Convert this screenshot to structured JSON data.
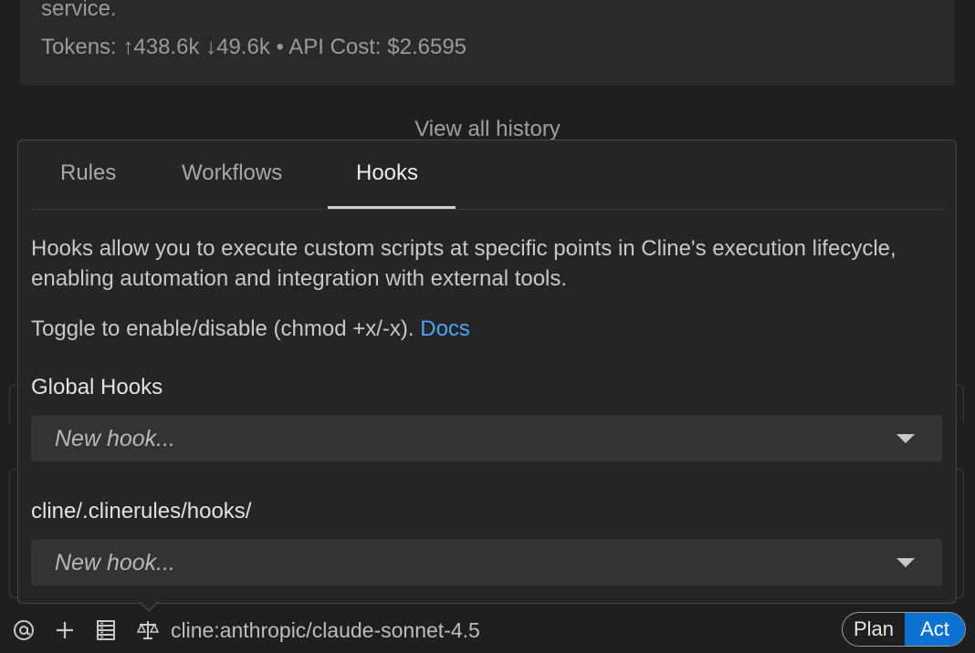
{
  "history": {
    "tail_text": "service.",
    "tokens_text": "Tokens: ↑438.6k ↓49.6k • API Cost: $2.6595",
    "view_all_label": "View all history"
  },
  "panel": {
    "tabs": [
      {
        "label": "Rules",
        "active": false
      },
      {
        "label": "Workflows",
        "active": false
      },
      {
        "label": "Hooks",
        "active": true
      }
    ],
    "description": "Hooks allow you to execute custom scripts at specific points in Cline's execution lifecycle, enabling automation and integration with external tools.",
    "toggle_text": "Toggle to enable/disable (chmod +x/-x).",
    "docs_link": "Docs",
    "sections": [
      {
        "label": "Global Hooks",
        "select_placeholder": "New hook..."
      },
      {
        "label": "cline/.clinerules/hooks/",
        "select_placeholder": "New hook..."
      }
    ]
  },
  "toolbar": {
    "icons": [
      "at-mention-icon",
      "plus-icon",
      "server-icon",
      "scale-icon"
    ],
    "model": "cline:anthropic/claude-sonnet-4.5",
    "mode": {
      "plan_label": "Plan",
      "act_label": "Act",
      "selected": "Act"
    }
  },
  "colors": {
    "background": "#1f1f1f",
    "panel": "#252526",
    "accent": "#0e72d1",
    "link": "#4da3ff"
  }
}
